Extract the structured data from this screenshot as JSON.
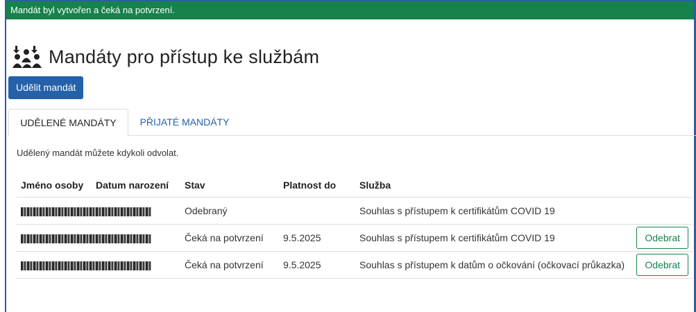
{
  "banner": {
    "message": "Mandát byl vytvořen a čeká na potvrzení."
  },
  "header": {
    "title": "Mandáty pro přístup ke službám",
    "icon": "people-arrows-icon"
  },
  "toolbar": {
    "grant_label": "Udělit mandát"
  },
  "tabs": [
    {
      "label": "UDĚLENÉ MANDÁTY",
      "active": true
    },
    {
      "label": "PŘIJATÉ MANDÁTY",
      "active": false
    }
  ],
  "info_text": "Udělený mandát můžete kdykoli odvolat.",
  "table": {
    "headers": {
      "name": "Jméno osoby",
      "birth": "Datum narození",
      "state": "Stav",
      "valid": "Platnost do",
      "service": "Služba"
    },
    "rows": [
      {
        "state": "Odebraný",
        "valid": "",
        "service": "Souhlas s přístupem k certifikátům COVID 19",
        "action": ""
      },
      {
        "state": "Čeká na potvrzení",
        "valid": "9.5.2025",
        "service": "Souhlas s přístupem k certifikátům COVID 19",
        "action": "Odebrat"
      },
      {
        "state": "Čeká na potvrzení",
        "valid": "9.5.2025",
        "service": "Souhlas s přístupem k datům o očkování (očkovací průkazka)",
        "action": "Odebrat"
      }
    ]
  },
  "colors": {
    "banner": "#16824c",
    "primary": "#2461a8",
    "frame": "#2c5f9e"
  }
}
